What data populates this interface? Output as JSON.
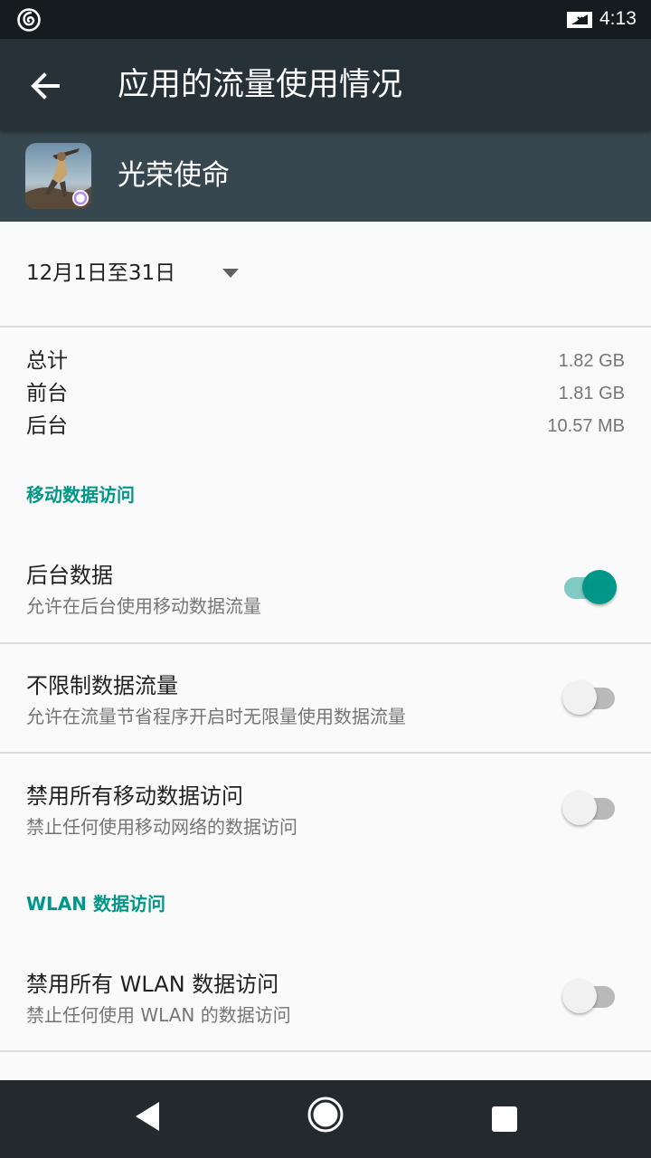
{
  "status_bar": {
    "time": "4:13",
    "left_icon": "netease-music-icon",
    "right_icon": "signal-off-icon"
  },
  "toolbar": {
    "title": "应用的流量使用情况",
    "back_icon": "arrow-back-icon"
  },
  "app_header": {
    "name": "光荣使命",
    "icon": "app-icon"
  },
  "cycle": {
    "label": "12月1日至31日",
    "dropdown_icon": "dropdown-arrow-icon"
  },
  "summary": [
    {
      "label": "总计",
      "value": "1.82 GB"
    },
    {
      "label": "前台",
      "value": "1.81 GB"
    },
    {
      "label": "后台",
      "value": "10.57 MB"
    }
  ],
  "sections": {
    "mobile": "移动数据访问",
    "wlan": "WLAN 数据访问"
  },
  "prefs": [
    {
      "title": "后台数据",
      "summary": "允许在后台使用移动数据流量",
      "checked": true
    },
    {
      "title": "不限制数据流量",
      "summary": "允许在流量节省程序开启时无限量使用数据流量",
      "checked": false
    },
    {
      "title": "禁用所有移动数据访问",
      "summary": "禁止任何使用移动网络的数据访问",
      "checked": false
    },
    {
      "title": "禁用所有 WLAN 数据访问",
      "summary": "禁止任何使用 WLAN 的数据访问",
      "checked": false
    }
  ],
  "colors": {
    "accent": "#009688",
    "toolbar": "#263238",
    "app_header": "#37474f",
    "status_bar": "#151b1e"
  },
  "nav_bar": {
    "icons": [
      "nav-back-icon",
      "nav-home-icon",
      "nav-recents-icon"
    ]
  }
}
